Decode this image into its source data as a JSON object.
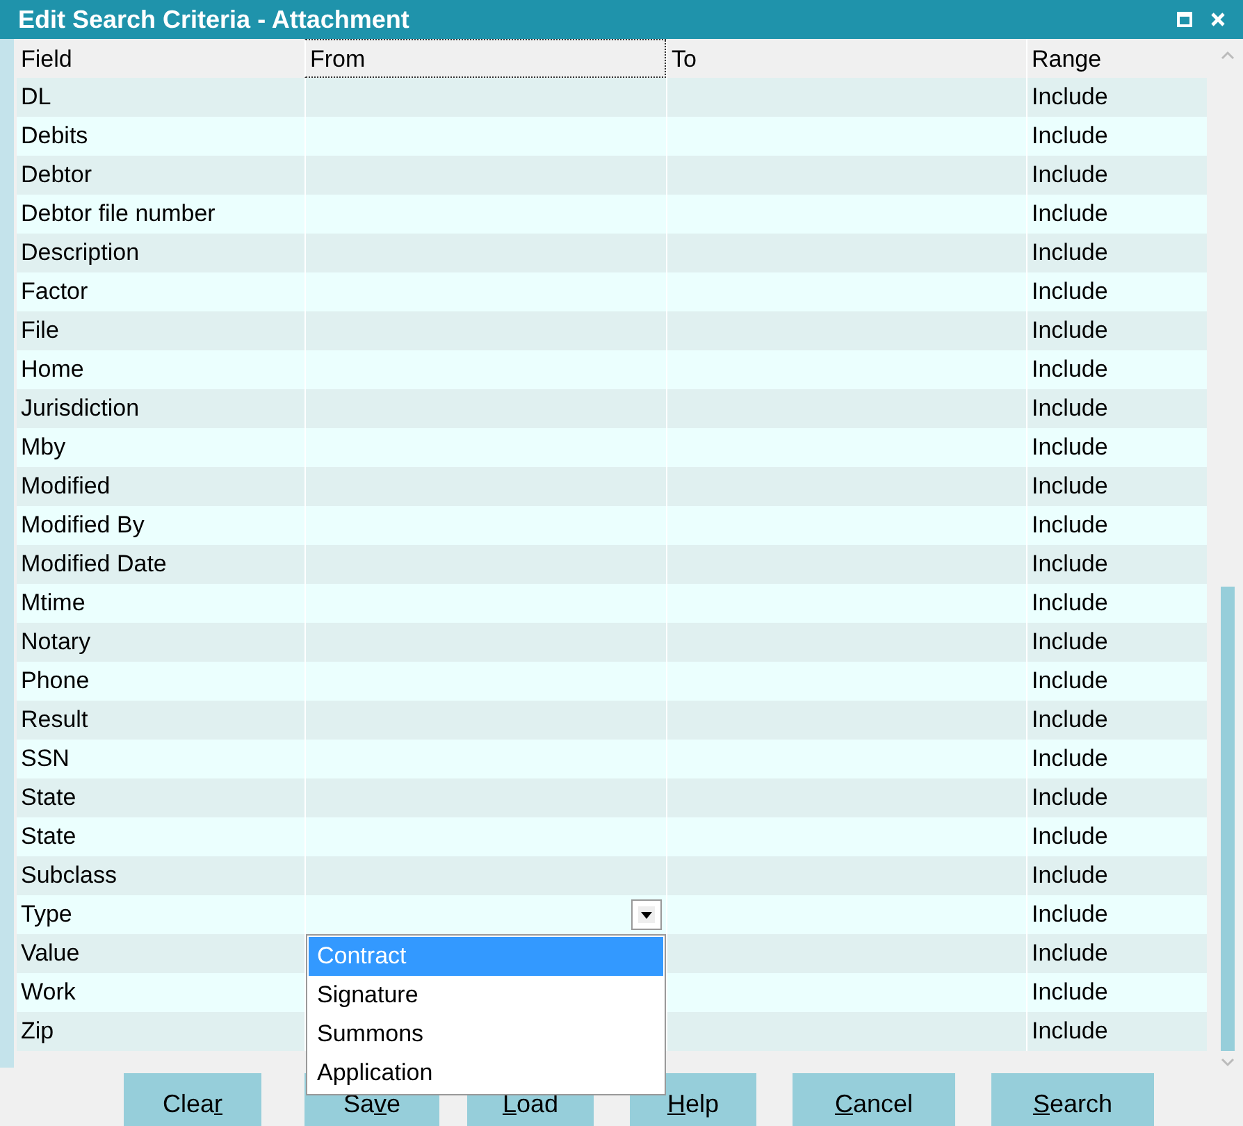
{
  "window": {
    "title": "Edit Search Criteria - Attachment"
  },
  "table": {
    "columns": [
      {
        "label": "Field",
        "focused": false
      },
      {
        "label": "From",
        "focused": true
      },
      {
        "label": "To",
        "focused": false
      },
      {
        "label": "Range",
        "focused": false
      }
    ],
    "rows": [
      {
        "field": "DL",
        "range": "Include",
        "kind": "plain"
      },
      {
        "field": "Debits",
        "range": "Include",
        "kind": "plain"
      },
      {
        "field": "Debtor",
        "range": "Include",
        "kind": "plain"
      },
      {
        "field": "Debtor file number",
        "range": "Include",
        "kind": "plain"
      },
      {
        "field": "Description",
        "range": "Include",
        "kind": "plain"
      },
      {
        "field": "Factor",
        "range": "Include",
        "kind": "plain"
      },
      {
        "field": "File",
        "range": "Include",
        "kind": "plain"
      },
      {
        "field": "Home",
        "range": "Include",
        "kind": "plain"
      },
      {
        "field": "Jurisdiction",
        "range": "Include",
        "kind": "plain"
      },
      {
        "field": "Mby",
        "range": "Include",
        "kind": "plain"
      },
      {
        "field": "Modified",
        "range": "Include",
        "kind": "plain"
      },
      {
        "field": "Modified By",
        "range": "Include",
        "kind": "plain"
      },
      {
        "field": "Modified Date",
        "range": "Include",
        "kind": "plain"
      },
      {
        "field": "Mtime",
        "range": "Include",
        "kind": "plain"
      },
      {
        "field": "Notary",
        "range": "Include",
        "kind": "plain"
      },
      {
        "field": "Phone",
        "range": "Include",
        "kind": "plain"
      },
      {
        "field": "Result",
        "range": "Include",
        "kind": "plain"
      },
      {
        "field": "SSN",
        "range": "Include",
        "kind": "plain"
      },
      {
        "field": "State",
        "range": "Include",
        "kind": "plain"
      },
      {
        "field": "State",
        "range": "Include",
        "kind": "plain"
      },
      {
        "field": "Subclass",
        "range": "Include",
        "kind": "plain"
      },
      {
        "field": "Type",
        "range": "Include",
        "kind": "dropdown"
      },
      {
        "field": "Value",
        "range": "Include",
        "kind": "plain"
      },
      {
        "field": "Work",
        "range": "Include",
        "kind": "plain"
      },
      {
        "field": "Zip",
        "range": "Include",
        "kind": "plain"
      }
    ]
  },
  "dropdown_options": [
    {
      "label": "Contract",
      "selected": true
    },
    {
      "label": "Signature",
      "selected": false
    },
    {
      "label": "Summons",
      "selected": false
    },
    {
      "label": "Application",
      "selected": false
    }
  ],
  "buttons": [
    {
      "label_start": "Clea",
      "mnemonic": "r"
    },
    {
      "label_start": "Sa",
      "mnemonic": "v",
      "label_end": "e"
    },
    {
      "mnemonic": "L",
      "label_end": "oad"
    },
    {
      "mnemonic": "H",
      "label_end": "elp"
    },
    {
      "mnemonic": "C",
      "label_end": "ancel"
    },
    {
      "mnemonic": "S",
      "label_end": "earch"
    }
  ]
}
